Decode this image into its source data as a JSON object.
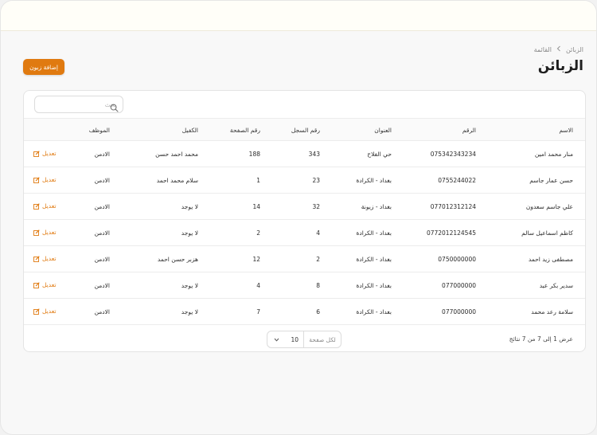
{
  "breadcrumb": {
    "root": "الزبائن",
    "current": "القائمة"
  },
  "page": {
    "title": "الزبائن"
  },
  "toolbar": {
    "add_label": "إضافة زبون"
  },
  "search": {
    "placeholder": "بحث",
    "value": ""
  },
  "table": {
    "headers": {
      "name": "الاسم",
      "phone": "الرقم",
      "address": "العنوان",
      "reg_no": "رقم السجل",
      "page_no": "رقم الصفحة",
      "guarantor": "الكفيل",
      "employee": "الموظف"
    },
    "edit_label": "تعديل",
    "rows": [
      {
        "name": "منار محمد امين",
        "phone": "075342343234",
        "address": "حي الفلاح",
        "reg_no": "343",
        "page_no": "188",
        "guarantor": "محمد احمد حسن",
        "employee": "الادمن"
      },
      {
        "name": "حسن عمار جاسم",
        "phone": "0755244022",
        "address": "بغداد - الكرادة",
        "reg_no": "23",
        "page_no": "1",
        "guarantor": "سلام محمد احمد",
        "employee": "الادمن"
      },
      {
        "name": "علي جاسم سعدون",
        "phone": "077012312124",
        "address": "بغداد - زيونة",
        "reg_no": "32",
        "page_no": "14",
        "guarantor": "لا يوجد",
        "employee": "الادمن"
      },
      {
        "name": "كاظم اسماعيل سالم",
        "phone": "0772012124545",
        "address": "بغداد - الكرادة",
        "reg_no": "4",
        "page_no": "2",
        "guarantor": "لا يوجد",
        "employee": "الادمن"
      },
      {
        "name": "مصطفى زيد احمد",
        "phone": "0750000000",
        "address": "بغداد - الكرادة",
        "reg_no": "2",
        "page_no": "12",
        "guarantor": "هزبر حسن احمد",
        "employee": "الادمن"
      },
      {
        "name": "سدير بكر عبد",
        "phone": "077000000",
        "address": "بغداد - الكرادة",
        "reg_no": "8",
        "page_no": "4",
        "guarantor": "لا يوجد",
        "employee": "الادمن"
      },
      {
        "name": "سلامة رعد محمد",
        "phone": "077000000",
        "address": "بغداد - الكرادة",
        "reg_no": "6",
        "page_no": "7",
        "guarantor": "لا يوجد",
        "employee": "الادمن"
      }
    ]
  },
  "pagination": {
    "summary": "عرض 1 إلى 7 من 7 نتائج",
    "per_page_label": "لكل صفحة",
    "per_page_value": "10"
  },
  "colors": {
    "accent": "#e07a10",
    "background": "#f8f8f8",
    "topbar": "#fffef8"
  },
  "icons": {
    "search": "search-icon",
    "edit": "edit-icon",
    "breadcrumb_sep": "chevron-left-icon",
    "select": "chevron-down-icon"
  }
}
